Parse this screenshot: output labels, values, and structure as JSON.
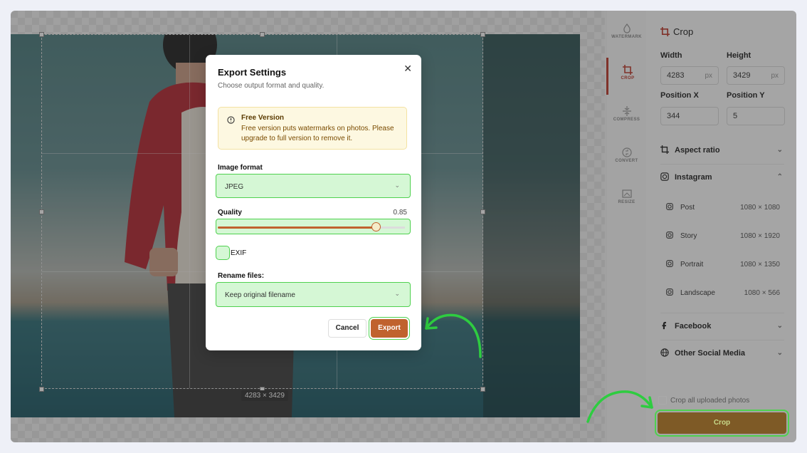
{
  "canvas": {
    "dimension_label": "4283 × 3429"
  },
  "toolbar": {
    "items": [
      {
        "label": "WATERMARK",
        "icon": "watermark-icon"
      },
      {
        "label": "CROP",
        "icon": "crop-icon",
        "active": true
      },
      {
        "label": "COMPRESS",
        "icon": "compress-icon"
      },
      {
        "label": "CONVERT",
        "icon": "convert-icon"
      },
      {
        "label": "RESIZE",
        "icon": "resize-icon"
      }
    ]
  },
  "panel": {
    "title": "Crop",
    "width_label": "Width",
    "width_value": "4283",
    "height_label": "Height",
    "height_value": "3429",
    "unit": "px",
    "posx_label": "Position X",
    "posx_value": "344",
    "posy_label": "Position Y",
    "posy_value": "5",
    "aspect_label": "Aspect ratio",
    "instagram_label": "Instagram",
    "instagram_items": [
      {
        "label": "Post",
        "dims": "1080 × 1080"
      },
      {
        "label": "Story",
        "dims": "1080 × 1920"
      },
      {
        "label": "Portrait",
        "dims": "1080 × 1350"
      },
      {
        "label": "Landscape",
        "dims": "1080 × 566"
      }
    ],
    "facebook_label": "Facebook",
    "other_label": "Other Social Media",
    "crop_all_label": "Crop all uploaded photos",
    "crop_button": "Crop"
  },
  "modal": {
    "title": "Export Settings",
    "subtitle": "Choose output format and quality.",
    "warning_title": "Free Version",
    "warning_body": "Free version puts watermarks on photos. Please upgrade to full version to remove it.",
    "format_label": "Image format",
    "format_value": "JPEG",
    "quality_label": "Quality",
    "quality_value": "0.85",
    "exif_label": "EXIF",
    "rename_label": "Rename files:",
    "rename_value": "Keep original filename",
    "cancel_label": "Cancel",
    "export_label": "Export"
  },
  "colors": {
    "accent": "#c0622e",
    "highlight": "#4fd14f",
    "crop_button": "#7e5a26"
  }
}
